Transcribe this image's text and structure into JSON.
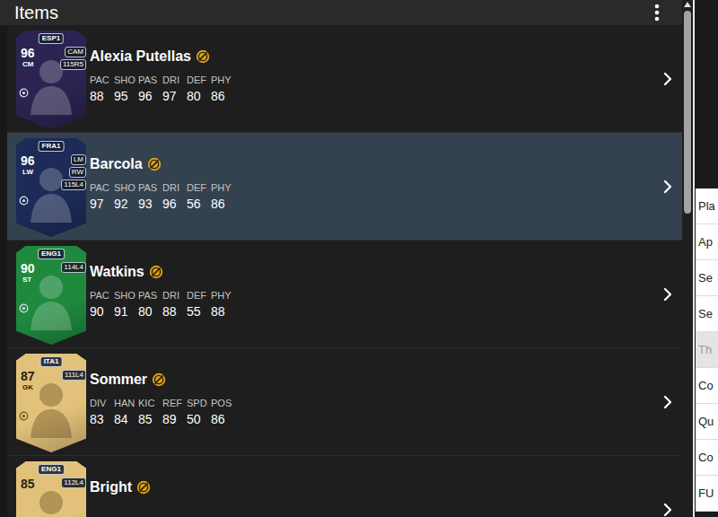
{
  "panel": {
    "title": "Items"
  },
  "items": [
    {
      "name": "Alexia Putellas",
      "rating": "96",
      "position": "CM",
      "league": "ESP1",
      "alt_positions": [
        "CAM"
      ],
      "skill": "115R5",
      "card_color": "#2b2452",
      "selected": false,
      "stats": [
        {
          "label": "PAC",
          "value": "88"
        },
        {
          "label": "SHO",
          "value": "95"
        },
        {
          "label": "PAS",
          "value": "96"
        },
        {
          "label": "DRI",
          "value": "97"
        },
        {
          "label": "DEF",
          "value": "80"
        },
        {
          "label": "PHY",
          "value": "86"
        }
      ]
    },
    {
      "name": "Barcola",
      "rating": "96",
      "position": "LW",
      "league": "FRA1",
      "alt_positions": [
        "LM",
        "RW"
      ],
      "skill": "115L4",
      "card_color": "#1d2b58",
      "selected": true,
      "stats": [
        {
          "label": "PAC",
          "value": "97"
        },
        {
          "label": "SHO",
          "value": "92"
        },
        {
          "label": "PAS",
          "value": "93"
        },
        {
          "label": "DRI",
          "value": "96"
        },
        {
          "label": "DEF",
          "value": "56"
        },
        {
          "label": "PHY",
          "value": "86"
        }
      ]
    },
    {
      "name": "Watkins",
      "rating": "90",
      "position": "ST",
      "league": "ENG1",
      "alt_positions": [],
      "skill": "114L4",
      "card_color": "#1f8a3e",
      "selected": false,
      "stats": [
        {
          "label": "PAC",
          "value": "90"
        },
        {
          "label": "SHO",
          "value": "91"
        },
        {
          "label": "PAS",
          "value": "80"
        },
        {
          "label": "DRI",
          "value": "88"
        },
        {
          "label": "DEF",
          "value": "55"
        },
        {
          "label": "PHY",
          "value": "88"
        }
      ]
    },
    {
      "name": "Sommer",
      "rating": "87",
      "position": "GK",
      "league": "ITA1",
      "alt_positions": [],
      "skill": "111L4",
      "card_color": "#e2c27a",
      "selected": false,
      "stats": [
        {
          "label": "DIV",
          "value": "83"
        },
        {
          "label": "HAN",
          "value": "84"
        },
        {
          "label": "KIC",
          "value": "85"
        },
        {
          "label": "REF",
          "value": "89"
        },
        {
          "label": "SPD",
          "value": "50"
        },
        {
          "label": "POS",
          "value": "86"
        }
      ]
    },
    {
      "name": "Bright",
      "rating": "85",
      "league": "ENG1",
      "alt_positions": [],
      "skill": "112L4",
      "card_color": "#e2c27a",
      "selected": false,
      "stats": []
    }
  ],
  "scrollbar": {
    "level": 0.4
  },
  "menu": {
    "items": [
      {
        "label": "Pla",
        "disabled": false
      },
      {
        "label": "Ap",
        "disabled": false
      },
      {
        "label": "Se",
        "disabled": false
      },
      {
        "label": "Se",
        "disabled": false
      },
      {
        "label": "Th",
        "disabled": true
      },
      {
        "label": "Co",
        "disabled": false
      },
      {
        "label": "Qu",
        "disabled": false
      },
      {
        "label": "Co",
        "disabled": false
      },
      {
        "label": "FU",
        "disabled": false
      }
    ]
  }
}
